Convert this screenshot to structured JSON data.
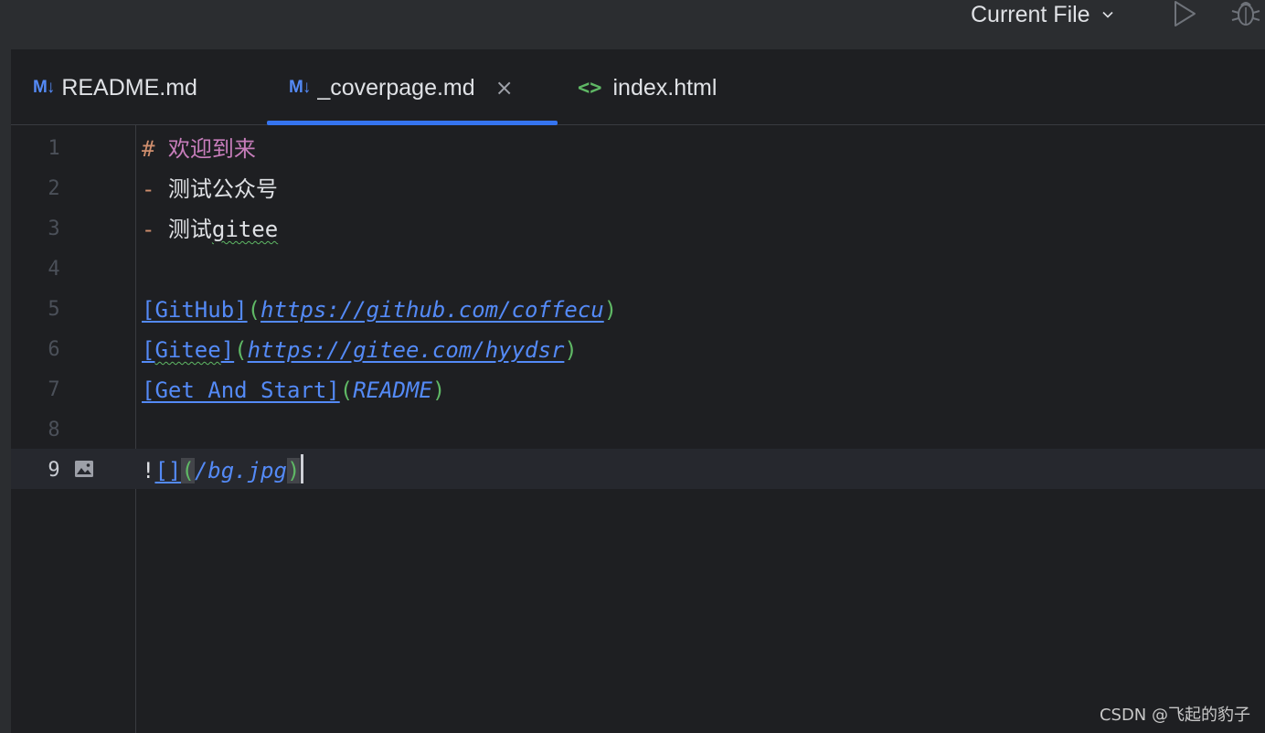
{
  "toolbar": {
    "run_config_label": "Current File",
    "icons": [
      "chevron-down-icon",
      "run-icon",
      "debug-icon"
    ]
  },
  "tabs": [
    {
      "icon_label": "M↓",
      "label": "README.md",
      "active": false
    },
    {
      "icon_label": "M↓",
      "label": "_coverpage.md",
      "active": true,
      "close": "×"
    },
    {
      "icon_label": "<>",
      "label": "index.html",
      "active": false
    }
  ],
  "editor": {
    "line_numbers": [
      "1",
      "2",
      "3",
      "4",
      "5",
      "6",
      "7",
      "8",
      "9"
    ],
    "current_line": "9",
    "tokens": {
      "l1_hash": "#",
      "l1_heading": "欢迎到来",
      "l2_dash": "-",
      "l2_text": "测试公众号",
      "l3_dash": "-",
      "l3_text_cn": "测试",
      "l3_text_en": "gitee",
      "l5_link_text": "[GitHub]",
      "l5_open": "(",
      "l5_url": "https://github.com/coffecu",
      "l5_close": ")",
      "l6_bracket_open": "[",
      "l6_link_word": "Gitee",
      "l6_bracket_close": "]",
      "l6_open": "(",
      "l6_url": "https://gitee.com/hyydsr",
      "l6_close": ")",
      "l7_link_text": "[Get And Start]",
      "l7_open": "(",
      "l7_url": "README",
      "l7_close": ")",
      "l9_bang": "!",
      "l9_brackets": "[]",
      "l9_open": "(",
      "l9_url": "/bg.jpg",
      "l9_close": ")"
    }
  },
  "watermark": "CSDN @飞起的豹子",
  "colors": {
    "background": "#1e1f22",
    "toolbar": "#2b2d30",
    "accent": "#3574f0",
    "link": "#548af7",
    "paren": "#5fb865",
    "heading": "#c77dbb",
    "marker": "#cf8e6d"
  }
}
